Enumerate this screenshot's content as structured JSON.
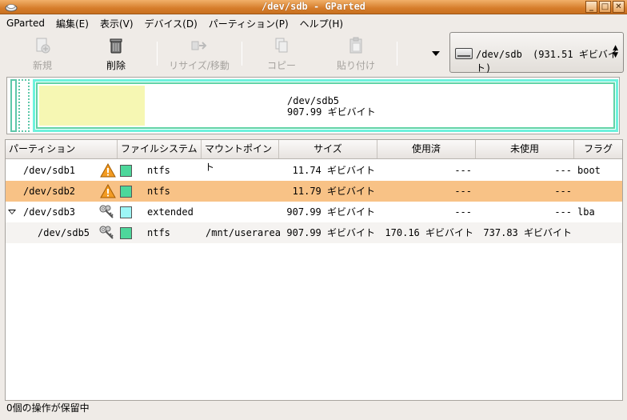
{
  "window": {
    "title": "/dev/sdb - GParted",
    "btn_min": "_",
    "btn_max": "□",
    "btn_close": "✕"
  },
  "menu": [
    "GParted",
    "編集(E)",
    "表示(V)",
    "デバイス(D)",
    "パーティション(P)",
    "ヘルプ(H)"
  ],
  "toolbar": {
    "new": "新規",
    "delete": "削除",
    "resize": "リサイズ/移動",
    "copy": "コピー",
    "paste": "貼り付け"
  },
  "device": {
    "name": "/dev/sdb",
    "size": "(931.51 ギビバイト)",
    "up": "▲",
    "down": "▼"
  },
  "diskgraph": {
    "name": "/dev/sdb5",
    "size": "907.99 ギビバイト",
    "used_fraction": 0.183
  },
  "table": {
    "headers": [
      "パーティション",
      "ファイルシステム",
      "マウントポイント",
      "サイズ",
      "使用済",
      "未使用",
      "フラグ"
    ],
    "rows": [
      {
        "partition": "/dev/sdb1",
        "fs": "ntfs",
        "mount": "",
        "size": "11.74 ギビバイト",
        "used": "---",
        "unused": "---",
        "flags": "boot",
        "icon": "warning-icon",
        "color": "#4dd79b"
      },
      {
        "partition": "/dev/sdb2",
        "fs": "ntfs",
        "mount": "",
        "size": "11.79 ギビバイト",
        "used": "---",
        "unused": "---",
        "flags": "",
        "icon": "warning-icon",
        "color": "#4dd79b"
      },
      {
        "partition": "/dev/sdb3",
        "fs": "extended",
        "mount": "",
        "size": "907.99 ギビバイト",
        "used": "---",
        "unused": "---",
        "flags": "lba",
        "icon": "keys-icon",
        "color": "#9df6f6"
      },
      {
        "partition": "/dev/sdb5",
        "fs": "ntfs",
        "mount": "/mnt/userarea",
        "size": "907.99 ギビバイト",
        "used": "170.16 ギビバイト",
        "unused": "737.83 ギビバイト",
        "flags": "",
        "icon": "keys-icon",
        "color": "#4dd79b"
      }
    ]
  },
  "status": "0個の操作が保留中",
  "colors": {
    "selection": "#f8c286",
    "ntfs": "#4dd79b",
    "extended": "#9df6f6",
    "used": "#f6f7b3",
    "titlebar": "#d67d2b"
  }
}
